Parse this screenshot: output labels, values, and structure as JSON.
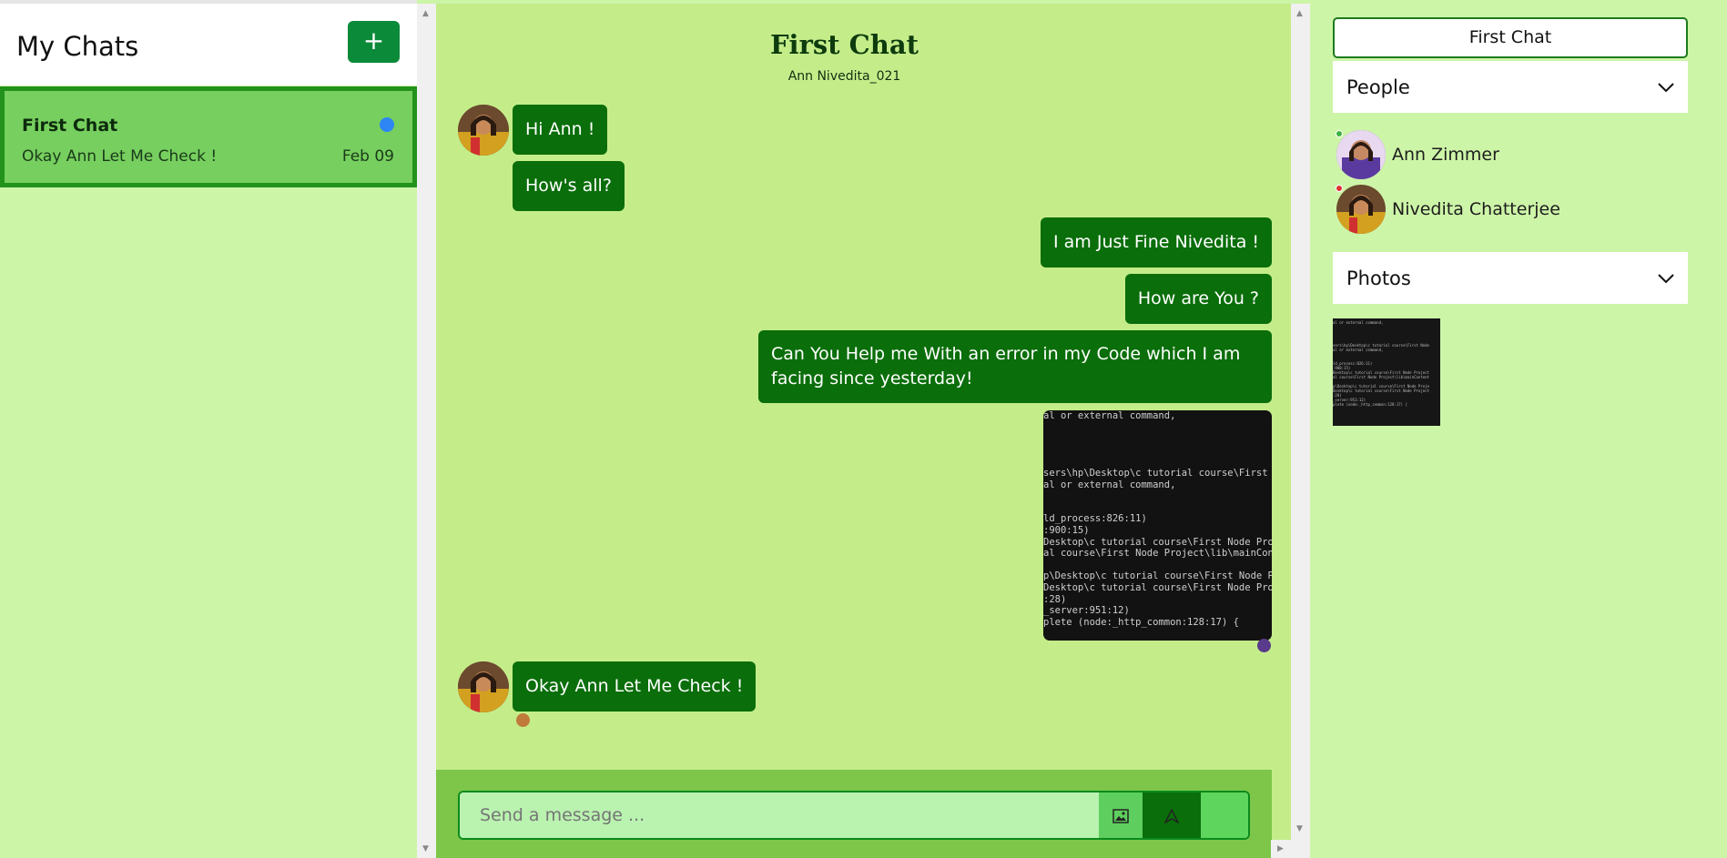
{
  "sidebar": {
    "title": "My Chats",
    "new_chat_label": "+",
    "chats": [
      {
        "title": "First Chat",
        "last_message": "Okay Ann Let Me Check !",
        "date": "Feb 09",
        "unread_color": "#2e86f5"
      }
    ]
  },
  "chat": {
    "title": "First Chat",
    "subtitle": "Ann Nivedita_021",
    "messages": [
      {
        "text": "Hi Ann !"
      },
      {
        "text": "How's all?"
      },
      {
        "text": "I am Just Fine Nivedita !"
      },
      {
        "text": "How are You ?"
      },
      {
        "text": "Can You Help me With an error in my Code which I am facing since yesterday!"
      },
      {
        "text": "Okay Ann Let Me Check !"
      }
    ],
    "image_text": [
      "al or external command,",
      "",
      "",
      "",
      "",
      "sers\\hp\\Desktop\\c tutorial course\\First Node",
      "al or external command,",
      "",
      "",
      "ld_process:826:11)",
      ":900:15)",
      "Desktop\\c tutorial course\\First Node Project",
      "al course\\First Node Project\\lib\\mainContent",
      "",
      "p\\Desktop\\c tutorial course\\First Node Proje",
      "Desktop\\c tutorial course\\First Node Project",
      ":28)",
      "_server:951:12)",
      "plete (node:_http_common:128:17) {"
    ],
    "input_placeholder": "Send a message ...",
    "icons": {
      "image": "image-icon",
      "send": "send-icon"
    }
  },
  "details": {
    "chat_name": "First Chat",
    "people_label": "People",
    "people": [
      {
        "name": "Ann Zimmer",
        "status_color": "#3cb043"
      },
      {
        "name": "Nivedita Chatterjee",
        "status_color": "#e03030"
      }
    ],
    "photos_label": "Photos"
  },
  "colors": {
    "accent": "#0a6e0a",
    "panel": "#c4ed8a",
    "sidebar": "#cdf5a8",
    "active_card": "#76cf5e"
  }
}
